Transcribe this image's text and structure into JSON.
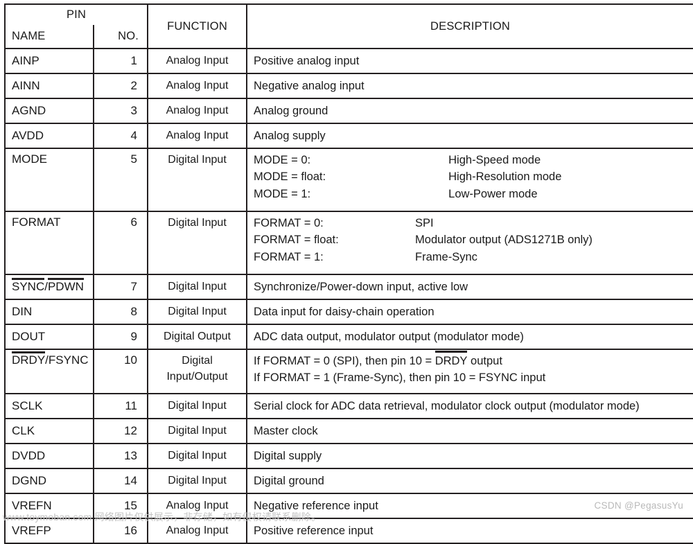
{
  "table": {
    "header": {
      "group_pin": "PIN",
      "name": "NAME",
      "no": "NO.",
      "function": "FUNCTION",
      "description": "DESCRIPTION"
    },
    "rows": [
      {
        "name": "AINP",
        "name_overline": [],
        "no": "1",
        "function": "Analog Input",
        "desc_lines": [
          "Positive analog input"
        ]
      },
      {
        "name": "AINN",
        "name_overline": [],
        "no": "2",
        "function": "Analog Input",
        "desc_lines": [
          "Negative analog input"
        ]
      },
      {
        "name": "AGND",
        "name_overline": [],
        "no": "3",
        "function": "Analog Input",
        "desc_lines": [
          "Analog ground"
        ]
      },
      {
        "name": "AVDD",
        "name_overline": [],
        "no": "4",
        "function": "Analog Input",
        "desc_lines": [
          "Analog supply"
        ]
      },
      {
        "name": "MODE",
        "name_overline": [],
        "no": "5",
        "function": "Digital Input",
        "desc_pairs": [
          {
            "cond": "MODE = 0:",
            "value": "High-Speed mode"
          },
          {
            "cond": "MODE = float:",
            "value": "High-Resolution mode"
          },
          {
            "cond": "MODE = 1:",
            "value": "Low-Power mode"
          }
        ]
      },
      {
        "name": "FORMAT",
        "name_overline": [],
        "no": "6",
        "function": "Digital Input",
        "desc_pairs": [
          {
            "cond": "FORMAT = 0:",
            "value": "SPI"
          },
          {
            "cond": "FORMAT = float:",
            "value": "Modulator output (ADS1271B only)"
          },
          {
            "cond": "FORMAT = 1:",
            "value": "Frame-Sync"
          }
        ]
      },
      {
        "name_parts": [
          {
            "text": "SYNC",
            "overline": true
          },
          {
            "text": "/",
            "overline": false
          },
          {
            "text": "PDWN",
            "overline": true
          }
        ],
        "no": "7",
        "function": "Digital Input",
        "desc_lines": [
          "Synchronize/Power-down input, active low"
        ]
      },
      {
        "name": "DIN",
        "name_overline": [],
        "no": "8",
        "function": "Digital Input",
        "desc_lines": [
          "Data input for daisy-chain operation"
        ]
      },
      {
        "name": "DOUT",
        "name_overline": [],
        "no": "9",
        "function": "Digital Output",
        "desc_lines": [
          "ADC data output, modulator output (modulator mode)"
        ]
      },
      {
        "name_parts": [
          {
            "text": "DRDY",
            "overline": true
          },
          {
            "text": "/FSYNC",
            "overline": false
          }
        ],
        "no": "10",
        "function_lines": [
          "Digital",
          "Input/Output"
        ],
        "desc_rich_lines": [
          [
            {
              "text": "If FORMAT = 0 (SPI), then pin 10 = ",
              "overline": false
            },
            {
              "text": "DRDY",
              "overline": true
            },
            {
              "text": " output",
              "overline": false
            }
          ],
          [
            {
              "text": "If FORMAT = 1 (Frame-Sync), then pin 10 = FSYNC input",
              "overline": false
            }
          ]
        ]
      },
      {
        "name": "SCLK",
        "name_overline": [],
        "no": "11",
        "function": "Digital Input",
        "desc_lines": [
          "Serial clock for ADC data retrieval, modulator clock output (modulator mode)"
        ]
      },
      {
        "name": "CLK",
        "name_overline": [],
        "no": "12",
        "function": "Digital Input",
        "desc_lines": [
          "Master clock"
        ]
      },
      {
        "name": "DVDD",
        "name_overline": [],
        "no": "13",
        "function": "Digital Input",
        "desc_lines": [
          "Digital supply"
        ]
      },
      {
        "name": "DGND",
        "name_overline": [],
        "no": "14",
        "function": "Digital Input",
        "desc_lines": [
          "Digital ground"
        ]
      },
      {
        "name": "VREFN",
        "name_overline": [],
        "no": "15",
        "function": "Analog Input",
        "desc_lines": [
          "Negative reference input"
        ]
      },
      {
        "name": "VREFP",
        "name_overline": [],
        "no": "16",
        "function": "Analog Input",
        "desc_lines": [
          "Positive reference input"
        ]
      }
    ]
  },
  "watermarks": {
    "csdn": "CSDN @PegasusYu",
    "bottom": "www.toymoban.com 网络图片仅供展示，非存储，如有侵权请联系删除。"
  },
  "colors": {
    "border": "#231f20",
    "text": "#1a1a1a",
    "watermark": "#c0c0c0",
    "background": "#ffffff"
  }
}
